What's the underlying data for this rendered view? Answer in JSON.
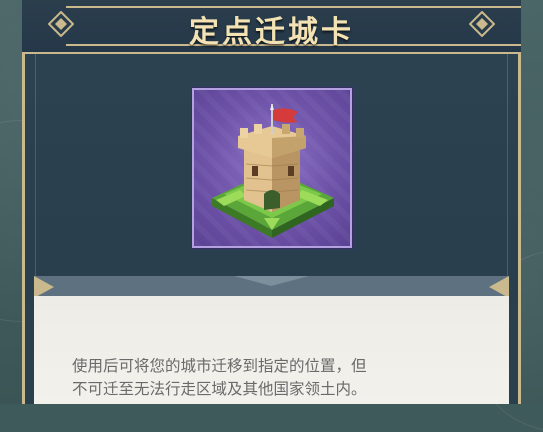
{
  "dialog": {
    "title": "定点迁城卡",
    "item_icon": "castle-tower-icon",
    "description_line1": "使用后可将您的城市迁移到指定的位置，但",
    "description_line2": "不可迁至无法行走区域及其他国家领土内。"
  },
  "colors": {
    "title_text": "#f3e2b3",
    "frame_gold": "#c9b98c",
    "panel_bg": "#2d4351",
    "icon_bg": "#6d52a8",
    "desc_bg": "#f0eee9",
    "desc_text": "#6a6a6a"
  }
}
